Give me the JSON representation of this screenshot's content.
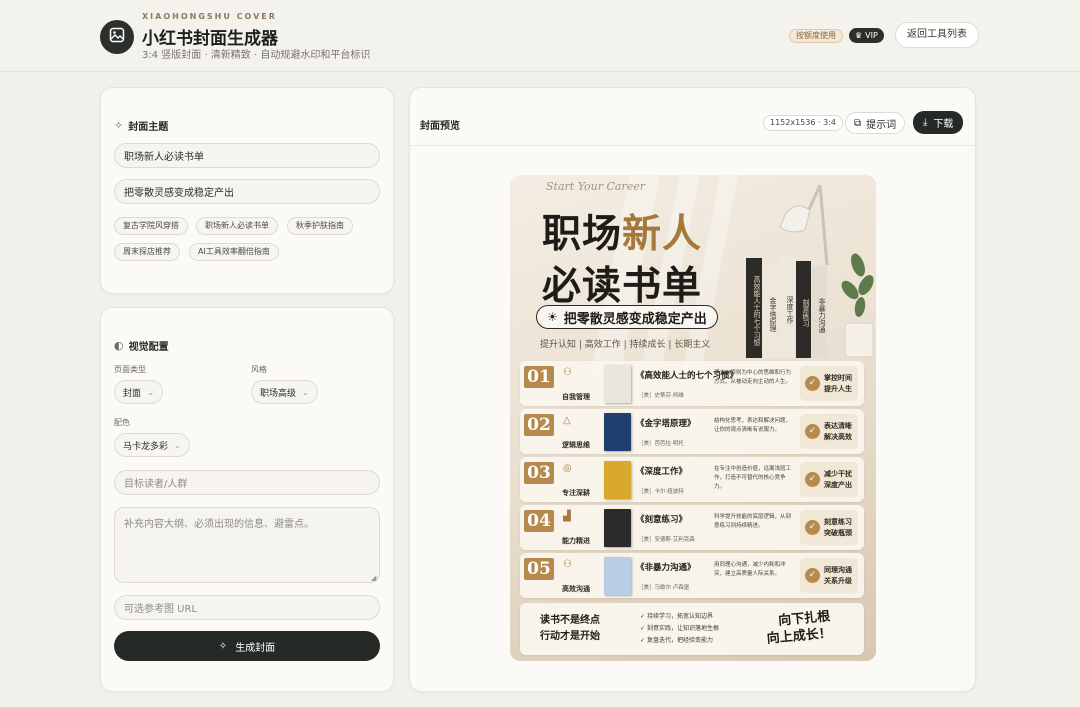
{
  "header": {
    "app_subtitle": "XIAOHONGSHU COVER",
    "app_title": "小红书封面生成器",
    "app_desc": "3:4 竖版封面 · 清新精致 · 自动规避水印和平台标识",
    "usage_badge": "按额度使用",
    "vip_badge": "VIP",
    "back_button": "返回工具列表"
  },
  "topic": {
    "section_title": "封面主题",
    "title_value": "职场新人必读书单",
    "subtitle_value": "把零散灵感变成稳定产出",
    "chips": [
      "复古学院风穿搭",
      "职场新人必读书单",
      "秋季护肤指南",
      "周末探店推荐",
      "AI工具效率翻倍指南"
    ]
  },
  "visual": {
    "section_title": "视觉配置",
    "page_type_label": "页面类型",
    "page_type_value": "封面",
    "style_label": "风格",
    "style_value": "职场高级",
    "color_label": "配色",
    "color_value": "马卡龙多彩",
    "audience_placeholder": "目标读者/人群",
    "details_placeholder": "补充内容大纲、必须出现的信息、避雷点。",
    "ref_placeholder": "可选参考图 URL",
    "generate_button": "生成封面"
  },
  "preview": {
    "title": "封面预览",
    "size_badge": "1152x1536 · 3:4",
    "prompt_button": "提示词",
    "download_button": "下载"
  },
  "cover": {
    "script_text": "Start Your Career",
    "title_line1_a": "职场",
    "title_line1_b": "新人",
    "title_line2": "必读书单",
    "pill_text": "把零散灵感变成稳定产出",
    "tags": "提升认知  |  高效工作  |  持续成长  |  长期主义",
    "rows": [
      {
        "num": "01",
        "label": "自我管理",
        "title": "《高效能人士的七个习惯》",
        "author": "［美］史蒂芬·柯维",
        "desc": "建立以原则为中心的思维和行为方式，从被动走向主动的人生。",
        "take1": "掌控时间",
        "take2": "提升人生",
        "color": "#e9e6df"
      },
      {
        "num": "02",
        "label": "逻辑思维",
        "title": "《金字塔原理》",
        "author": "［美］芭芭拉·明托",
        "desc": "结构化思考，表达和解决问题，让你的观点清晰有说服力。",
        "take1": "表达清晰",
        "take2": "解决高效",
        "color": "#1f3f6e"
      },
      {
        "num": "03",
        "label": "专注深耕",
        "title": "《深度工作》",
        "author": "［美］卡尔·纽波特",
        "desc": "在专注中创造价值，远离浅层工作，打造不可替代的核心竞争力。",
        "take1": "减少干扰",
        "take2": "深度产出",
        "color": "#d9a92c"
      },
      {
        "num": "04",
        "label": "能力精进",
        "title": "《刻意练习》",
        "author": "［美］安德斯·艾利克森",
        "desc": "科学提升技能的底层逻辑，从刻意练习到持续精进。",
        "take1": "刻意练习",
        "take2": "突破瓶颈",
        "color": "#2a2a2a"
      },
      {
        "num": "05",
        "label": "高效沟通",
        "title": "《非暴力沟通》",
        "author": "［美］马歇尔·卢森堡",
        "desc": "用同理心沟通，减少内耗和冲突，建立高质量人际关系。",
        "take1": "同理沟通",
        "take2": "关系升级",
        "color": "#b9cde4"
      }
    ],
    "footer_left1": "读书不是终点",
    "footer_left2": "行动才是开始",
    "footer_mid": [
      "持续学习，拓宽认知边界",
      "刻意实践，让知识落地生根",
      "复盘迭代，把经验变能力"
    ],
    "footer_right1": "向下扎根",
    "footer_right2": "向上成长！",
    "spines": [
      "高效能人士的七个习惯",
      "金字塔原理",
      "深度工作",
      "刻意练习",
      "非暴力沟通"
    ]
  },
  "colors": {
    "accent_gold": "#b68a4c",
    "dark_button": "#262a27",
    "background": "#f2f0ea"
  }
}
